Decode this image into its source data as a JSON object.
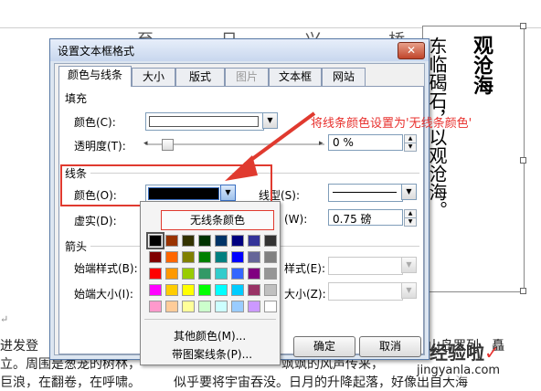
{
  "document": {
    "vertical_title": "观沧海",
    "vertical_poem": "东临碣石，以观沧海。",
    "faint_header_glyphs": "至 日 兴 桥",
    "line1_start": "进发登",
    "line1_end": "山岛罗列，矗",
    "line2_start": "立。周围是葱茏的树林，",
    "line2_mid": "飒飒的风声传来，",
    "line3_start": "巨浪，在翻卷，在呼啸。",
    "line3_mid": "似乎要将宇宙吞没。日月的升降起落，好像出自大海",
    "watermark_main": "经验啦",
    "watermark_check": "✓",
    "watermark_sub": "jingyanla.com",
    "paragraph_mark": "↵"
  },
  "dialog": {
    "title": "设置文本框格式",
    "close_icon": "✕",
    "tabs": [
      {
        "label": "颜色与线条",
        "active": true
      },
      {
        "label": "大小"
      },
      {
        "label": "版式"
      },
      {
        "label": "图片",
        "disabled": true
      },
      {
        "label": "文本框"
      },
      {
        "label": "网站"
      }
    ],
    "fill": {
      "section": "填充",
      "color_label": "颜色(C):",
      "transparency_label": "透明度(T):",
      "transparency_value": "0 %"
    },
    "line": {
      "section": "线条",
      "color_label": "颜色(O):",
      "dash_label": "虚实(D):",
      "style_label": "线型(S):",
      "weight_label_suffix": "(W):",
      "weight_value": "0.75 磅"
    },
    "arrows": {
      "section": "箭头",
      "begin_style_label": "始端样式(B):",
      "begin_size_label": "始端大小(I):",
      "end_style_label_suffix": "样式(E):",
      "end_size_label_suffix": "大小(Z):"
    },
    "buttons": {
      "ok": "确定",
      "cancel": "取消"
    }
  },
  "color_popup": {
    "no_line": "无线条颜色",
    "more_colors": "其他颜色(M)...",
    "patterned_lines": "带图案线条(P)...",
    "swatches": [
      [
        "#000000",
        "#993300",
        "#333300",
        "#003300",
        "#003366",
        "#000080",
        "#333399",
        "#333333"
      ],
      [
        "#800000",
        "#FF6600",
        "#808000",
        "#008000",
        "#008080",
        "#0000FF",
        "#666699",
        "#808080"
      ],
      [
        "#FF0000",
        "#FF9900",
        "#99CC00",
        "#339966",
        "#33CCCC",
        "#3366FF",
        "#800080",
        "#969696"
      ],
      [
        "#FF00FF",
        "#FFCC00",
        "#FFFF00",
        "#00FF00",
        "#00FFFF",
        "#00CCFF",
        "#993366",
        "#C0C0C0"
      ],
      [
        "#FF99CC",
        "#FFCC99",
        "#FFFF99",
        "#CCFFCC",
        "#CCFFFF",
        "#99CCFF",
        "#CC99FF",
        "#FFFFFF"
      ]
    ]
  },
  "annotation": {
    "text": "将线条颜色设置为'无线条颜色'",
    "color": "#e8312e"
  }
}
